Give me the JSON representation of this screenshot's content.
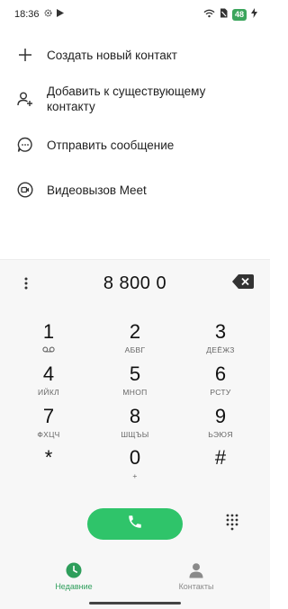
{
  "status_bar": {
    "time": "18:36",
    "battery": "48",
    "icons_left": [
      "settings-gear-icon",
      "play-store-icon"
    ],
    "icons_right": [
      "wifi-icon",
      "sim-off-icon",
      "battery-icon",
      "charging-icon"
    ]
  },
  "menu": {
    "items": [
      {
        "label": "Создать новый контакт",
        "icon": "plus-icon"
      },
      {
        "label": "Добавить к существующему контакту",
        "icon": "person-add-icon"
      },
      {
        "label": "Отправить сообщение",
        "icon": "message-icon"
      },
      {
        "label": "Видеовызов Meet",
        "icon": "video-call-icon"
      }
    ]
  },
  "dialer": {
    "number": "8 800 0",
    "keys": [
      {
        "digit": "1",
        "letters": ""
      },
      {
        "digit": "2",
        "letters": "АБВГ"
      },
      {
        "digit": "3",
        "letters": "ДЕЁЖЗ"
      },
      {
        "digit": "4",
        "letters": "ИЙКЛ"
      },
      {
        "digit": "5",
        "letters": "МНОП"
      },
      {
        "digit": "6",
        "letters": "РСТУ"
      },
      {
        "digit": "7",
        "letters": "ФХЦЧ"
      },
      {
        "digit": "8",
        "letters": "ШЩЪЫ"
      },
      {
        "digit": "9",
        "letters": "ЬЭЮЯ"
      },
      {
        "digit": "*",
        "letters": ""
      },
      {
        "digit": "0",
        "letters": "+"
      },
      {
        "digit": "#",
        "letters": ""
      }
    ]
  },
  "bottom_nav": {
    "recent_label": "Недавние",
    "contacts_label": "Контакты",
    "active": "recent"
  },
  "colors": {
    "accent": "#2fc46a",
    "nav_active": "#2e9e5b",
    "nav_inactive": "#8a8a8a",
    "battery": "#3ba55c"
  }
}
